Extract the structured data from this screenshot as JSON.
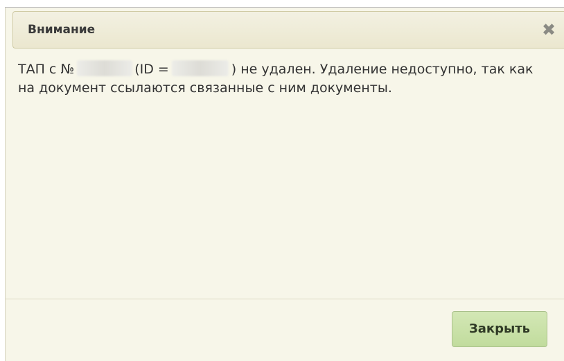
{
  "dialog": {
    "title": "Внимание",
    "close_icon": "✖",
    "message": {
      "part1": "ТАП с №",
      "part2": "(ID =",
      "part3": ") не удален. Удаление недоступно, так как",
      "line2": "на документ ссылаются связанные с ним документы."
    },
    "close_button_label": "Закрыть"
  },
  "colors": {
    "dialog_background": "#f7f6e9",
    "button_background": "#c9e1a8"
  }
}
